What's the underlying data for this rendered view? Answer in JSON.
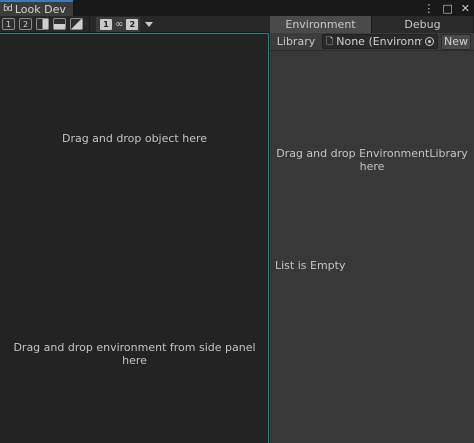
{
  "window": {
    "tab_title": "Look Dev",
    "tab_icon": "ɓd",
    "menu_icon": "⋮",
    "maximize_icon": "□",
    "close_icon": "✕"
  },
  "toolbar": {
    "single_view_1": "1",
    "single_view_2": "2",
    "env_1": "1",
    "link_glyph": "∞",
    "env_2": "2"
  },
  "viewport": {
    "drop_object_text": "Drag and drop object here",
    "drop_environment_text": "Drag and drop environment from side panel here"
  },
  "side_panel": {
    "tabs": [
      {
        "label": "Environment",
        "active": true
      },
      {
        "label": "Debug",
        "active": false
      }
    ],
    "library_label": "Library",
    "library_field_value": "None (Environment",
    "new_button": "New",
    "drop_library_text": "Drag and drop EnvironmentLibrary here",
    "list_empty_text": "List is Empty"
  }
}
